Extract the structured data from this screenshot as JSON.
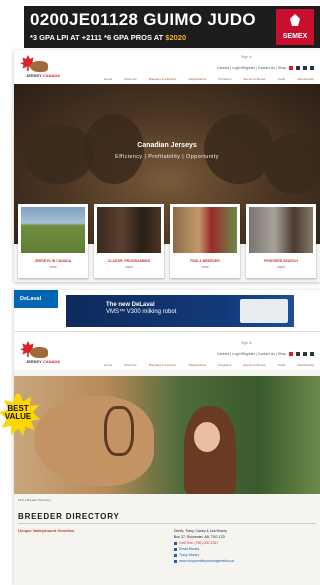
{
  "top_ad": {
    "line1_pre": "0200JE01128",
    "line1_bold": "GUIMO JUDO",
    "line2_a": "*3 GPA LPI AT ",
    "line2_a_val": "+2111",
    "line2_b": " *6 GPA PROS AT ",
    "line2_b_val": "$2020",
    "brand": "SEMEX"
  },
  "site": {
    "logo_text_a": "JERSEY",
    "logo_text_b": "CANADA",
    "signin": "Sign In",
    "util_text": "Careers | Login/Register | Contact Us | Shop",
    "nav": [
      "Home",
      "About Us",
      "Breeding & Genetics",
      "Registrations",
      "Programs",
      "Events & Shows",
      "Youth",
      "Membership",
      "Marketplace",
      "News & Resources"
    ]
  },
  "hero1": {
    "title": "Canadian Jerseys",
    "subtitle": "Efficiency | Profitability | Opportunity"
  },
  "tiles": [
    {
      "label": "JERSEYS IN CANADA",
      "link": "VIEW"
    },
    {
      "label": "CLASSIF. PROGRAMMES",
      "link": "VIEW"
    },
    {
      "label": "FIND A BREEDER",
      "link": "VIEW"
    },
    {
      "label": "PEDIGREE SEARCH",
      "link": "VIEW"
    }
  ],
  "mid_ad": {
    "brand": "DeLaval",
    "line1": "The new DeLaval",
    "line2": "VMS™ V300 milking robot"
  },
  "breeder": {
    "crumb": "Find a Breeder Directory",
    "heading": "BREEDER DIRECTORY",
    "farm": "Unique Valleymount Genetics",
    "contact_name": "Derek, Tracy, Casey & Lea Money",
    "address": "Box 27, Rochester, AB, T0G 1Z0",
    "phone": "Cell/Text: (780) 000-2337",
    "links": [
      "Email Money",
      "Tracy Money",
      "www.uniquevalleymountgenetics.ca"
    ]
  },
  "burst": {
    "line1": "BEST",
    "line2": "VALUE"
  },
  "colors": {
    "brand_red": "#d8232a",
    "link_red": "#c0392b",
    "semex_red": "#c8102e",
    "delaval_blue": "#0066b3"
  }
}
